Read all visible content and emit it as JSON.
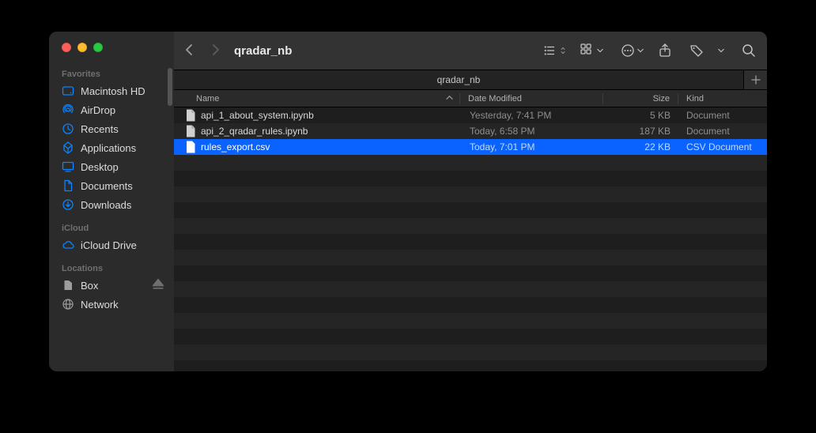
{
  "window": {
    "title": "qradar_nb",
    "tab": "qradar_nb"
  },
  "sidebar": {
    "sections": [
      {
        "header": "Favorites",
        "items": [
          {
            "icon": "hdd",
            "label": "Macintosh HD"
          },
          {
            "icon": "airdrop",
            "label": "AirDrop"
          },
          {
            "icon": "clock",
            "label": "Recents"
          },
          {
            "icon": "apps",
            "label": "Applications"
          },
          {
            "icon": "desktop",
            "label": "Desktop"
          },
          {
            "icon": "doc",
            "label": "Documents"
          },
          {
            "icon": "download",
            "label": "Downloads"
          }
        ]
      },
      {
        "header": "iCloud",
        "items": [
          {
            "icon": "cloud",
            "label": "iCloud Drive"
          }
        ]
      },
      {
        "header": "Locations",
        "items": [
          {
            "icon": "folder",
            "label": "Box",
            "eject": true
          },
          {
            "icon": "globe",
            "label": "Network"
          }
        ]
      }
    ]
  },
  "columns": {
    "name": "Name",
    "date": "Date Modified",
    "size": "Size",
    "kind": "Kind"
  },
  "files": [
    {
      "name": "api_1_about_system.ipynb",
      "date": "Yesterday, 7:41 PM",
      "size": "5 KB",
      "kind": "Document",
      "selected": false
    },
    {
      "name": "api_2_qradar_rules.ipynb",
      "date": "Today, 6:58 PM",
      "size": "187 KB",
      "kind": "Document",
      "selected": false
    },
    {
      "name": "rules_export.csv",
      "date": "Today, 7:01 PM",
      "size": "22 KB",
      "kind": "CSV Document",
      "selected": true
    }
  ],
  "filler_rows": 13
}
